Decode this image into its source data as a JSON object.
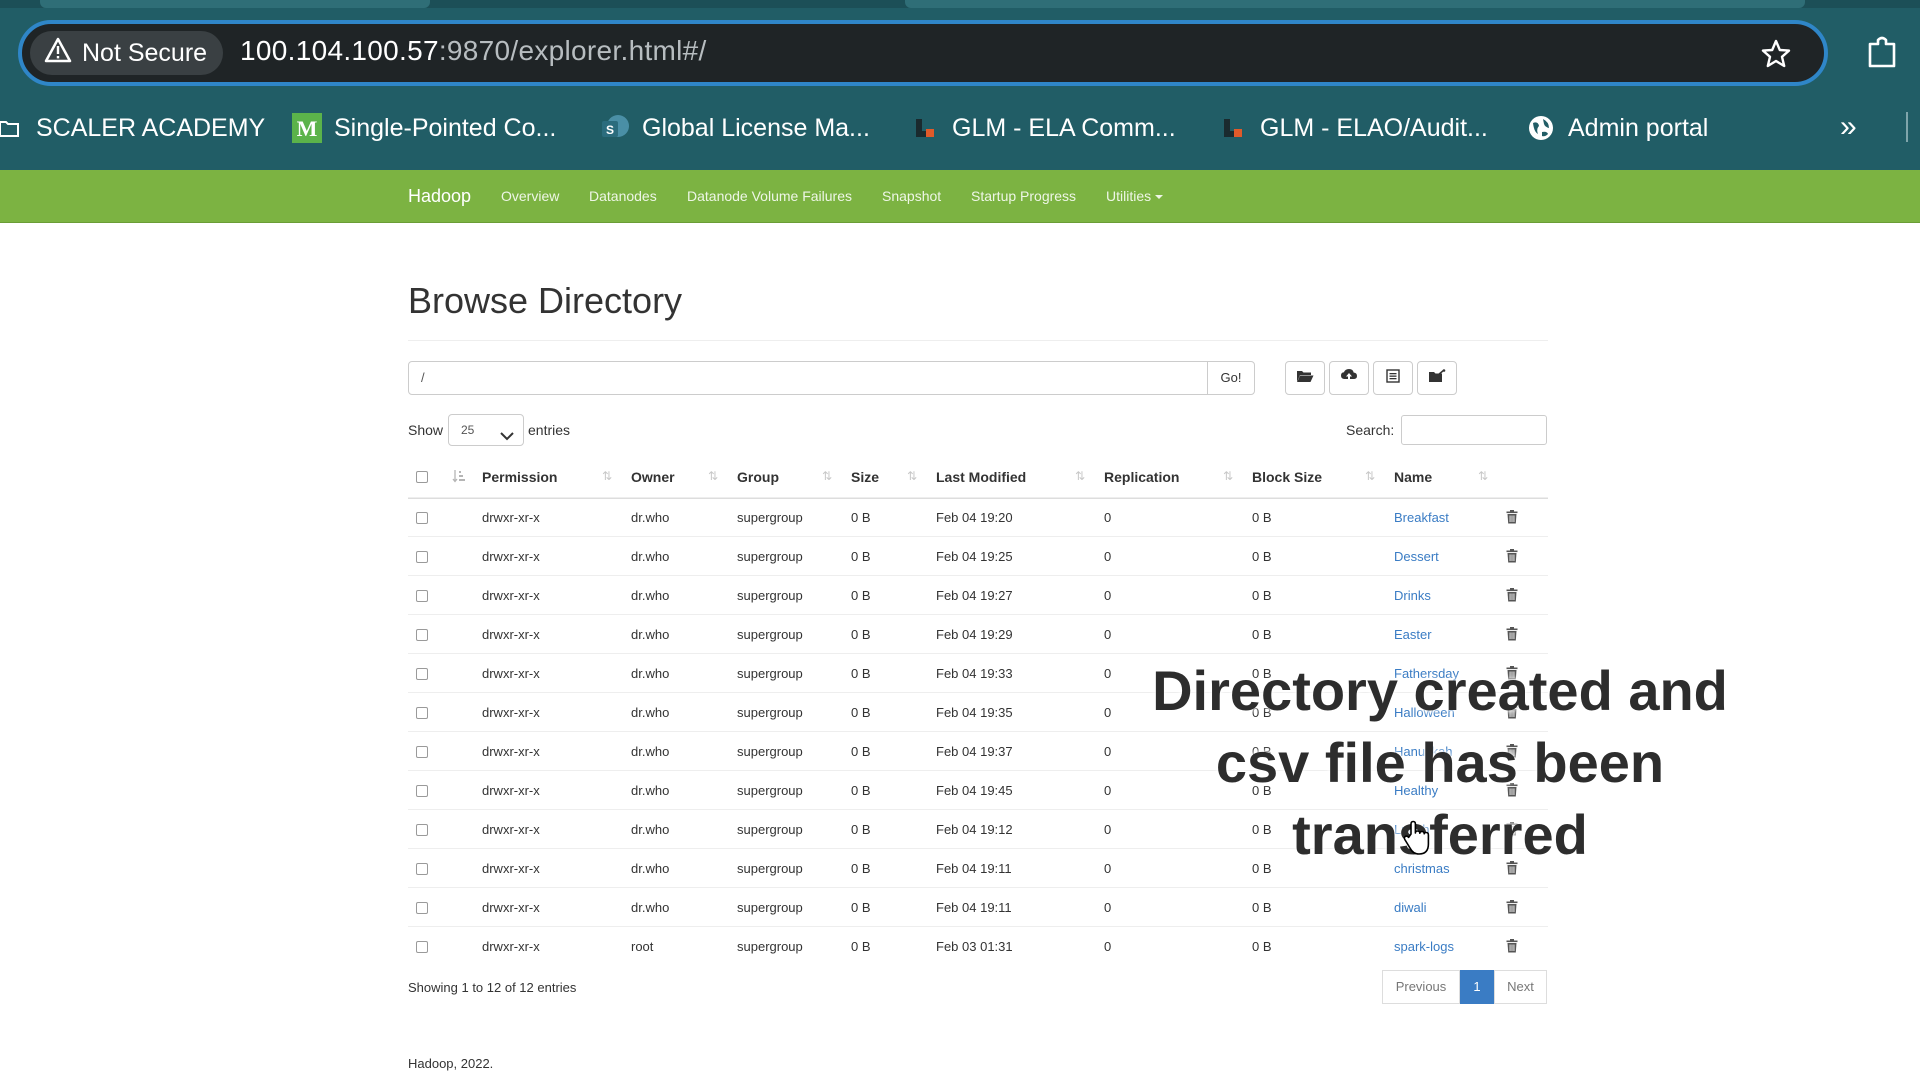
{
  "browser": {
    "security_label": "Not Secure",
    "url_host": "100.104.100.57",
    "url_rest": ":9870/explorer.html#/",
    "bookmarks": [
      {
        "label": "SCALER ACADEMY",
        "icon": "folder-icon"
      },
      {
        "label": "Single-Pointed Co...",
        "icon": "medium-logo-icon"
      },
      {
        "label": "Global License Ma...",
        "icon": "sharepoint-icon"
      },
      {
        "label": "GLM - ELA Comm...",
        "icon": "glm-icon"
      },
      {
        "label": "GLM - ELAO/Audit...",
        "icon": "glm-icon"
      },
      {
        "label": "Admin portal",
        "icon": "globe-icon"
      }
    ],
    "more_label": "»"
  },
  "navbar": {
    "brand": "Hadoop",
    "items": [
      "Overview",
      "Datanodes",
      "Datanode Volume Failures",
      "Snapshot",
      "Startup Progress",
      "Utilities"
    ]
  },
  "page": {
    "title": "Browse Directory",
    "path_value": "/",
    "go_label": "Go!",
    "toolbar_icons": [
      "folder-open-icon",
      "upload-icon",
      "list-icon",
      "cut-paste-icon"
    ],
    "show_label": "Show",
    "entries_value": "25",
    "entries_label": "entries",
    "search_label": "Search:",
    "search_value": ""
  },
  "table": {
    "columns": [
      "Permission",
      "Owner",
      "Group",
      "Size",
      "Last Modified",
      "Replication",
      "Block Size",
      "Name"
    ],
    "rows": [
      {
        "permission": "drwxr-xr-x",
        "owner": "dr.who",
        "group": "supergroup",
        "size": "0 B",
        "modified": "Feb 04 19:20",
        "replication": "0",
        "block": "0 B",
        "name": "Breakfast"
      },
      {
        "permission": "drwxr-xr-x",
        "owner": "dr.who",
        "group": "supergroup",
        "size": "0 B",
        "modified": "Feb 04 19:25",
        "replication": "0",
        "block": "0 B",
        "name": "Dessert"
      },
      {
        "permission": "drwxr-xr-x",
        "owner": "dr.who",
        "group": "supergroup",
        "size": "0 B",
        "modified": "Feb 04 19:27",
        "replication": "0",
        "block": "0 B",
        "name": "Drinks"
      },
      {
        "permission": "drwxr-xr-x",
        "owner": "dr.who",
        "group": "supergroup",
        "size": "0 B",
        "modified": "Feb 04 19:29",
        "replication": "0",
        "block": "0 B",
        "name": "Easter"
      },
      {
        "permission": "drwxr-xr-x",
        "owner": "dr.who",
        "group": "supergroup",
        "size": "0 B",
        "modified": "Feb 04 19:33",
        "replication": "0",
        "block": "0 B",
        "name": "Fathersday"
      },
      {
        "permission": "drwxr-xr-x",
        "owner": "dr.who",
        "group": "supergroup",
        "size": "0 B",
        "modified": "Feb 04 19:35",
        "replication": "0",
        "block": "0 B",
        "name": "Halloween"
      },
      {
        "permission": "drwxr-xr-x",
        "owner": "dr.who",
        "group": "supergroup",
        "size": "0 B",
        "modified": "Feb 04 19:37",
        "replication": "0",
        "block": "0 B",
        "name": "Hanukkah"
      },
      {
        "permission": "drwxr-xr-x",
        "owner": "dr.who",
        "group": "supergroup",
        "size": "0 B",
        "modified": "Feb 04 19:45",
        "replication": "0",
        "block": "0 B",
        "name": "Healthy"
      },
      {
        "permission": "drwxr-xr-x",
        "owner": "dr.who",
        "group": "supergroup",
        "size": "0 B",
        "modified": "Feb 04 19:12",
        "replication": "0",
        "block": "0 B",
        "name": "Lunch"
      },
      {
        "permission": "drwxr-xr-x",
        "owner": "dr.who",
        "group": "supergroup",
        "size": "0 B",
        "modified": "Feb 04 19:11",
        "replication": "0",
        "block": "0 B",
        "name": "christmas"
      },
      {
        "permission": "drwxr-xr-x",
        "owner": "dr.who",
        "group": "supergroup",
        "size": "0 B",
        "modified": "Feb 04 19:11",
        "replication": "0",
        "block": "0 B",
        "name": "diwali"
      },
      {
        "permission": "drwxr-xr-x",
        "owner": "root",
        "group": "supergroup",
        "size": "0 B",
        "modified": "Feb 03 01:31",
        "replication": "0",
        "block": "0 B",
        "name": "spark-logs"
      }
    ],
    "showing_text": "Showing 1 to 12 of 12 entries"
  },
  "pagination": {
    "previous": "Previous",
    "current": "1",
    "next": "Next"
  },
  "footer": {
    "text": "Hadoop, 2022."
  },
  "overlay": {
    "lines": [
      "Directory created and",
      "csv file has been",
      "transferred"
    ]
  },
  "colors": {
    "navbar": "#7cb342",
    "browser_chrome": "#215d66",
    "link": "#3a7cc4"
  }
}
